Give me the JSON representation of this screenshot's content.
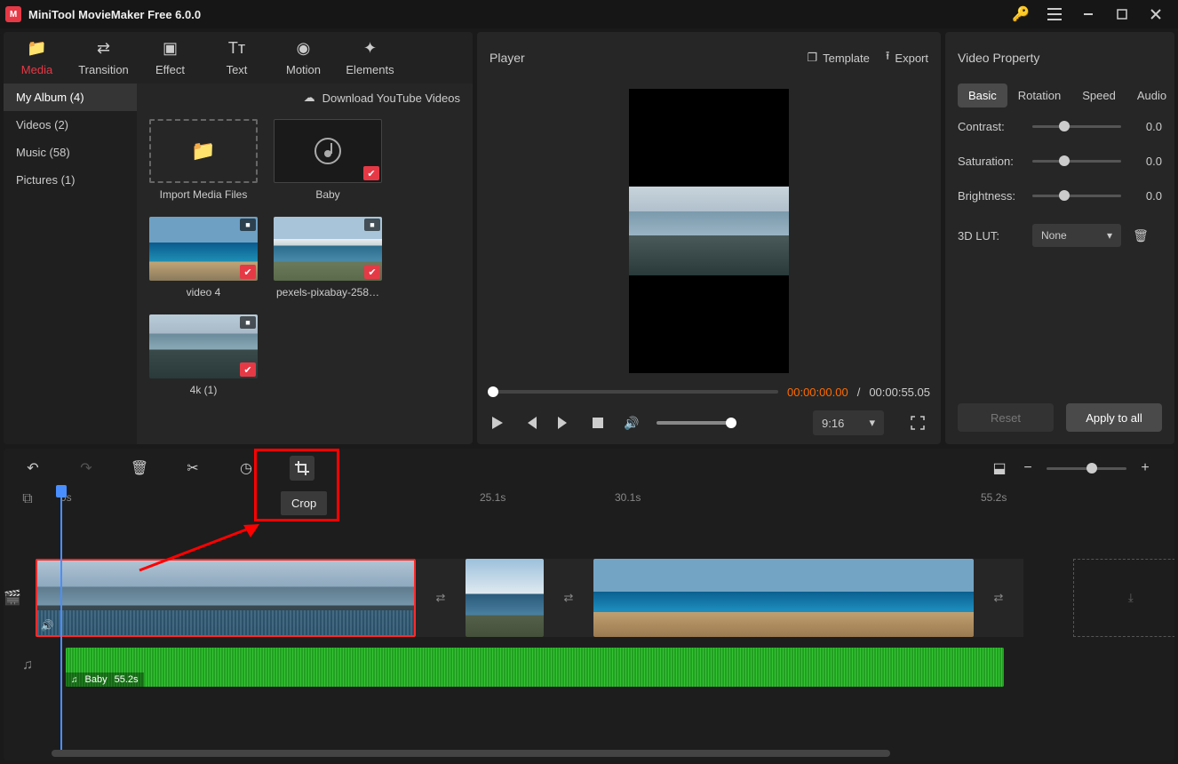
{
  "titlebar": {
    "app_name": "MiniTool MovieMaker Free 6.0.0"
  },
  "tabs": {
    "media": "Media",
    "transition": "Transition",
    "effect": "Effect",
    "text": "Text",
    "motion": "Motion",
    "elements": "Elements"
  },
  "side": {
    "my_album": "My Album (4)",
    "videos": "Videos (2)",
    "music": "Music (58)",
    "pictures": "Pictures (1)"
  },
  "dl_bar": "Download YouTube Videos",
  "media": {
    "import": "Import Media Files",
    "baby": "Baby",
    "video4": "video 4",
    "pexels": "pexels-pixabay-258…",
    "fourk": "4k (1)"
  },
  "player": {
    "title": "Player",
    "template": "Template",
    "export": "Export",
    "current": "00:00:00.00",
    "sep": " / ",
    "total": "00:00:55.05",
    "aspect": "9:16"
  },
  "property": {
    "title": "Video Property",
    "tabs": {
      "basic": "Basic",
      "rotation": "Rotation",
      "speed": "Speed",
      "audio": "Audio"
    },
    "contrast": "Contrast:",
    "saturation": "Saturation:",
    "brightness": "Brightness:",
    "val": "0.0",
    "lut_label": "3D LUT:",
    "lut_value": "None",
    "reset": "Reset",
    "apply": "Apply to all"
  },
  "timeline": {
    "tooltip": "Crop",
    "marks": {
      "m0": "0s",
      "m1": "25.1s",
      "m2": "30.1s",
      "m3": "55.2s"
    },
    "audio_name": "Baby",
    "audio_dur": "55.2s"
  }
}
